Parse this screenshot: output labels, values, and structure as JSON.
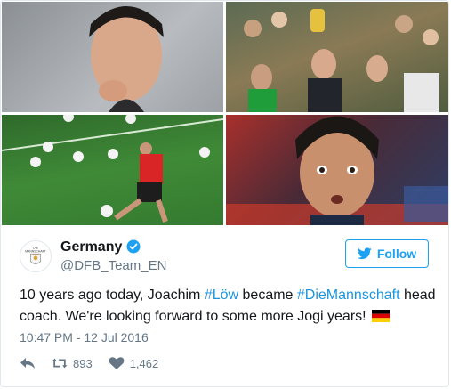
{
  "photos": [
    {
      "name": "photo-coach-smiling"
    },
    {
      "name": "photo-trophy-celebration"
    },
    {
      "name": "photo-training-pitch"
    },
    {
      "name": "photo-surprised-face"
    }
  ],
  "tweet": {
    "author_name": "Germany",
    "author_handle": "@DFB_Team_EN",
    "follow_label": "Follow",
    "text_before": "10 years ago today, Joachim ",
    "hashtag_1": "#Löw",
    "text_middle": " became ",
    "hashtag_2": "#DieMannschaft",
    "text_after": " head coach. We're looking forward to some more Jogi years! ",
    "timestamp": "10:47 PM - 12 Jul 2016",
    "retweet_count": "893",
    "like_count": "1,462"
  },
  "icons": {
    "verified": "verified-badge-icon",
    "bird": "twitter-bird-icon",
    "reply": "reply-icon",
    "retweet": "retweet-icon",
    "like": "heart-icon",
    "flag": "germany-flag-icon",
    "avatar": "dfb-crest-icon"
  },
  "colors": {
    "accent": "#1da1f2",
    "hashtag": "#1b95e0",
    "muted": "#657786",
    "text": "#14171a"
  }
}
